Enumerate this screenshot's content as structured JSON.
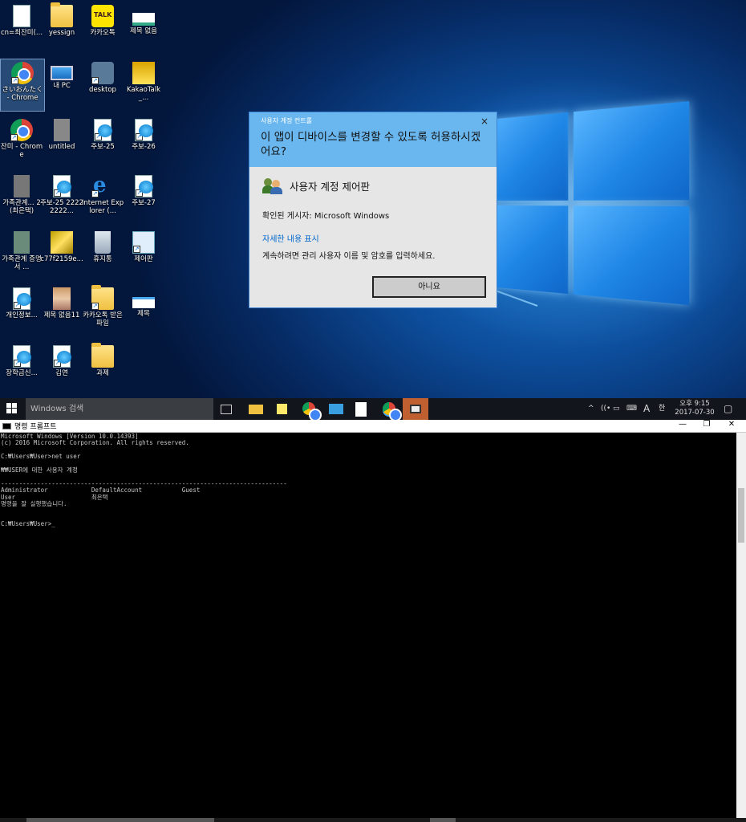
{
  "desktop": {
    "icons": [
      {
        "label": "cn=최잔미(..."
      },
      {
        "label": "yessign"
      },
      {
        "label": "카카오톡"
      },
      {
        "label": "제목 없음"
      },
      {
        "label": "さいおんたく - Chrome"
      },
      {
        "label": "내 PC"
      },
      {
        "label": "desktop"
      },
      {
        "label": "KakaoTalk_..."
      },
      {
        "label": "잔미 - Chrome"
      },
      {
        "label": "untitled"
      },
      {
        "label": "주보-25"
      },
      {
        "label": "주보-26"
      },
      {
        "label": "가족관계... 2(최은택)"
      },
      {
        "label": "주보-25 22222222..."
      },
      {
        "label": "Internet Explorer (..."
      },
      {
        "label": "주보-27"
      },
      {
        "label": "가족관계 증명서 ..."
      },
      {
        "label": "c77f2159e..."
      },
      {
        "label": "휴지통"
      },
      {
        "label": "제어판"
      },
      {
        "label": "개인정보..."
      },
      {
        "label": "제목 없음11"
      },
      {
        "label": "카카오톡 받은 파일"
      },
      {
        "label": "제목"
      },
      {
        "label": "장학금신..."
      },
      {
        "label": "김연"
      },
      {
        "label": "과제"
      }
    ],
    "kakao_badge": "TALK"
  },
  "uac": {
    "header_small": "사용자 계정 컨트롤",
    "question": "이 앱이 디바이스를 변경할 수 있도록 허용하시겠어요?",
    "close": "×",
    "app_name": "사용자 계정 제어판",
    "publisher": "확인된 게시자: Microsoft Windows",
    "details_link": "자세한 내용 표시",
    "instruction": "계속하려면 관리 사용자 이름 및 암호를 입력하세요.",
    "no_button": "아니요"
  },
  "taskbar": {
    "search_placeholder": "Windows 검색",
    "time": "오후 9:15",
    "date": "2017-07-30",
    "ime": "A",
    "ime2": "한"
  },
  "cmd": {
    "title": "명령 프롬프트",
    "minimize": "—",
    "restore": "❐",
    "close": "✕",
    "output": "Microsoft Windows [Version 10.0.14393]\n(c) 2016 Microsoft Corporation. All rights reserved.\n\nC:₩Users₩User>net user\n\n₩₩USER에 대한 사용자 계정\n\n-------------------------------------------------------------------------------\nAdministrator            DefaultAccount           Guest\nUser                     최은택\n명령을 잘 실행했습니다.\n\n\nC:₩Users₩User>_"
  }
}
